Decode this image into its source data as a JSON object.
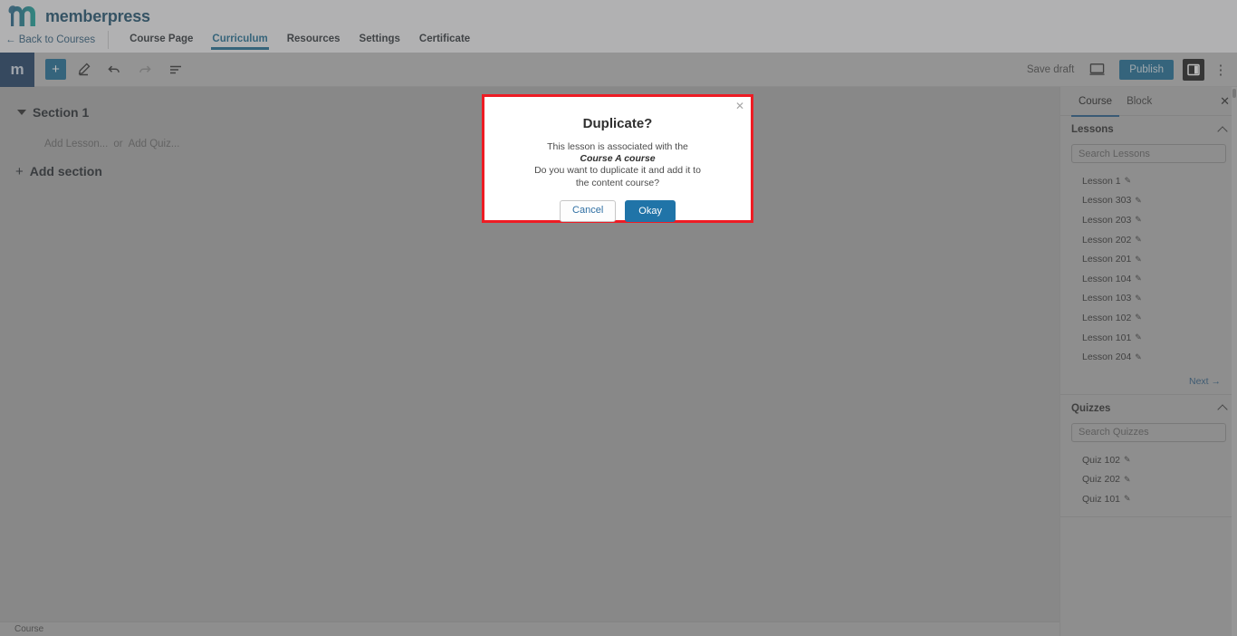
{
  "brand": {
    "wordmark": "memberpress",
    "logo_icon": "memberpress-m-logo",
    "logo_color_left": "#2b6e8f",
    "logo_color_right": "#1aa39a"
  },
  "header": {
    "back_link": "← Back to Courses",
    "tabs": [
      {
        "label": "Course Page",
        "active": false
      },
      {
        "label": "Curriculum",
        "active": true
      },
      {
        "label": "Resources",
        "active": false
      },
      {
        "label": "Settings",
        "active": false
      },
      {
        "label": "Certificate",
        "active": false
      }
    ],
    "active_tab_color": "#1d6c92"
  },
  "editor_toolbar": {
    "wp_logo": "m",
    "add_block_label": "+",
    "tools": [
      {
        "name": "add-block-button",
        "glyph": "+"
      },
      {
        "name": "edit-tool-button",
        "glyph": "✏"
      },
      {
        "name": "undo-button",
        "glyph": "↶"
      },
      {
        "name": "redo-button",
        "glyph": "↷"
      },
      {
        "name": "list-view-button",
        "glyph": "☰"
      }
    ],
    "save_draft_label": "Save draft",
    "preview_icon": "desktop-preview-icon",
    "publish_label": "Publish",
    "publish_color": "#1a6b94",
    "settings_toggle_icon": "settings-sidebar-icon",
    "options_icon": "kebab-menu-icon"
  },
  "canvas": {
    "section_title": "Section 1",
    "add_lesson_label": "Add Lesson...",
    "or_label": "or",
    "add_quiz_label": "Add Quiz...",
    "add_section_label": "Add section",
    "add_section_glyph": "+"
  },
  "statusbar": {
    "breadcrumb": "Course"
  },
  "sidebar": {
    "tabs": [
      {
        "label": "Course",
        "active": true
      },
      {
        "label": "Block",
        "active": false
      }
    ],
    "close_glyph": "✕",
    "lessons_panel": {
      "title": "Lessons",
      "search_placeholder": "Search Lessons",
      "search_value": "",
      "items": [
        {
          "label": "Lesson 1"
        },
        {
          "label": "Lesson 303"
        },
        {
          "label": "Lesson 203"
        },
        {
          "label": "Lesson 202"
        },
        {
          "label": "Lesson 201"
        },
        {
          "label": "Lesson 104"
        },
        {
          "label": "Lesson 103"
        },
        {
          "label": "Lesson 102"
        },
        {
          "label": "Lesson 101"
        },
        {
          "label": "Lesson 204"
        }
      ],
      "next_label": "Next →"
    },
    "quizzes_panel": {
      "title": "Quizzes",
      "search_placeholder": "Search Quizzes",
      "search_value": "",
      "items": [
        {
          "label": "Quiz 102"
        },
        {
          "label": "Quiz 202"
        },
        {
          "label": "Quiz 101"
        }
      ]
    },
    "item_edit_icon": "pencil-icon"
  },
  "modal": {
    "title": "Duplicate?",
    "close_glyph": "✕",
    "line1": "This lesson is associated with the",
    "emphasis": "Course A course",
    "line2": "Do you want to duplicate it and add it to",
    "line3": "the content course?",
    "cancel_label": "Cancel",
    "okay_label": "Okay",
    "border_color": "#ee1c24",
    "okay_color": "#2074a8"
  }
}
